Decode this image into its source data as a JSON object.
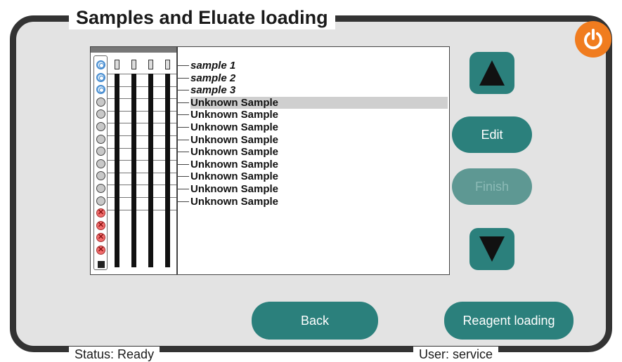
{
  "header": {
    "title": "Samples and Eluate loading"
  },
  "footer": {
    "status": "Status: Ready",
    "user": "User: service"
  },
  "samples": [
    {
      "label": "sample 1",
      "style": "italic",
      "well": "blue"
    },
    {
      "label": "sample 2",
      "style": "italic",
      "well": "blue"
    },
    {
      "label": "sample 3",
      "style": "italic",
      "well": "blue"
    },
    {
      "label": "Unknown Sample",
      "style": "bold",
      "well": "grey",
      "selected": true
    },
    {
      "label": "Unknown Sample",
      "style": "bold",
      "well": "grey"
    },
    {
      "label": "Unknown Sample",
      "style": "bold",
      "well": "grey"
    },
    {
      "label": "Unknown Sample",
      "style": "bold",
      "well": "grey"
    },
    {
      "label": "Unknown Sample",
      "style": "bold",
      "well": "grey"
    },
    {
      "label": "Unknown Sample",
      "style": "bold",
      "well": "grey"
    },
    {
      "label": "Unknown Sample",
      "style": "bold",
      "well": "grey"
    },
    {
      "label": "Unknown Sample",
      "style": "bold",
      "well": "grey"
    },
    {
      "label": "Unknown Sample",
      "style": "bold",
      "well": "grey"
    }
  ],
  "empty_wells": [
    "red-x",
    "red-x",
    "red-x",
    "red-x"
  ],
  "buttons": {
    "edit": "Edit",
    "disabled_label": "Finish",
    "back": "Back",
    "reagent_loading": "Reagent loading"
  },
  "icons": {
    "up": "arrow-up-icon",
    "down": "arrow-down-icon",
    "power": "power-icon"
  },
  "colors": {
    "accent": "#2b807c",
    "power": "#f07c1f",
    "frame": "#333333",
    "panel": "#e3e3e3"
  }
}
